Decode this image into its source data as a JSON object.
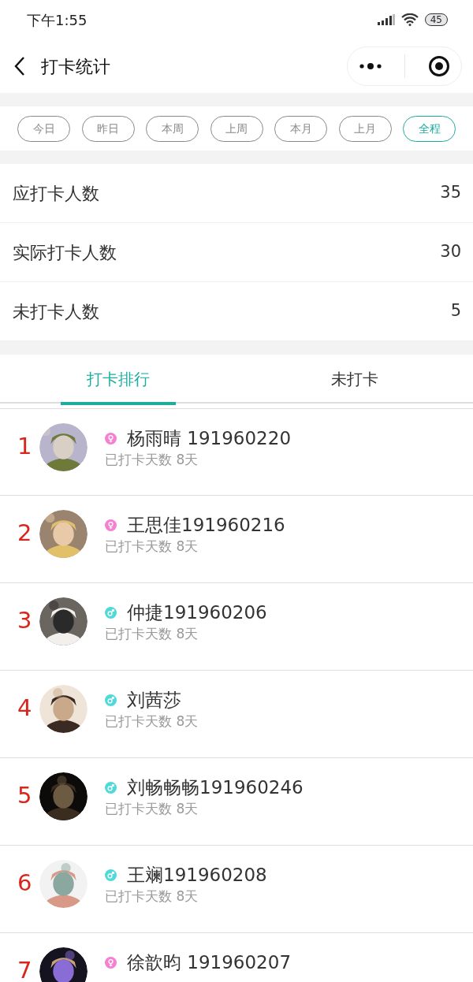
{
  "status_bar": {
    "time": "下午1:55",
    "battery": "45"
  },
  "header": {
    "title": "打卡统计"
  },
  "filters": [
    {
      "label": "今日",
      "selected": false
    },
    {
      "label": "昨日",
      "selected": false
    },
    {
      "label": "本周",
      "selected": false
    },
    {
      "label": "上周",
      "selected": false
    },
    {
      "label": "本月",
      "selected": false
    },
    {
      "label": "上月",
      "selected": false
    },
    {
      "label": "全程",
      "selected": true
    }
  ],
  "stats": [
    {
      "label": "应打卡人数",
      "value": "35"
    },
    {
      "label": "实际打卡人数",
      "value": "30"
    },
    {
      "label": "未打卡人数",
      "value": "5"
    }
  ],
  "tabs": [
    {
      "label": "打卡排行",
      "selected": true
    },
    {
      "label": "未打卡",
      "selected": false
    }
  ],
  "ranking": [
    {
      "rank": "1",
      "kind": "female",
      "name": "杨雨晴 191960220",
      "days": "已打卡天数 8天"
    },
    {
      "rank": "2",
      "kind": "female",
      "name": "王思佳191960216",
      "days": "已打卡天数 8天"
    },
    {
      "rank": "3",
      "kind": "male",
      "name": "仲捷191960206",
      "days": "已打卡天数 8天"
    },
    {
      "rank": "4",
      "kind": "male",
      "name": "刘茜莎",
      "days": "已打卡天数 8天"
    },
    {
      "rank": "5",
      "kind": "male",
      "name": "刘畅畅畅191960246",
      "days": "已打卡天数 8天"
    },
    {
      "rank": "6",
      "kind": "male",
      "name": "王斓191960208",
      "days": "已打卡天数 8天"
    },
    {
      "rank": "7",
      "kind": "female",
      "name": "徐歆昀 191960207"
    }
  ]
}
